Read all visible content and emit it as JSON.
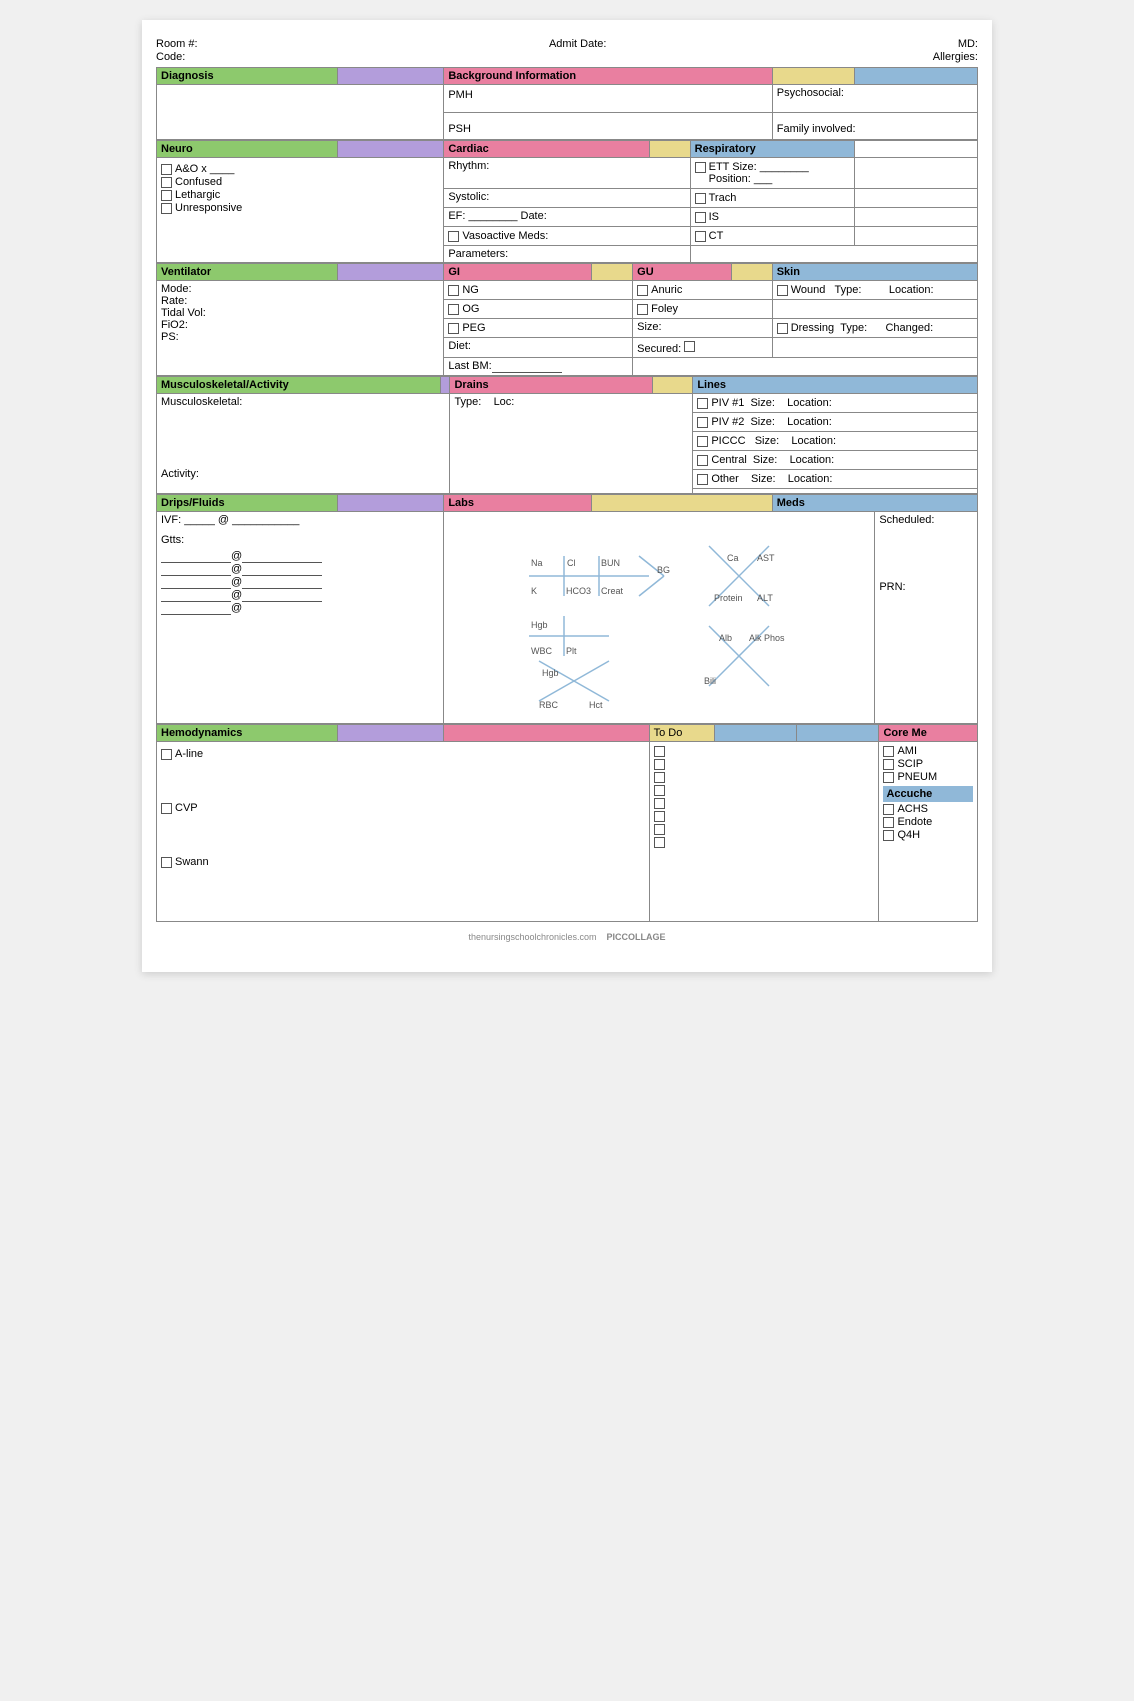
{
  "header": {
    "room_label": "Room #:",
    "admit_label": "Admit Date:",
    "md_label": "MD:",
    "code_label": "Code:",
    "allergies_label": "Allergies:"
  },
  "sections": {
    "diagnosis_label": "Diagnosis",
    "background_label": "Background Information",
    "pmh_label": "PMH",
    "psh_label": "PSH",
    "psychosocial_label": "Psychosocial:",
    "family_label": "Family involved:",
    "neuro_label": "Neuro",
    "cardiac_label": "Cardiac",
    "respiratory_label": "Respiratory",
    "neuro_items": [
      "A&O x ____",
      "Confused",
      "Lethargic",
      "Unresponsive"
    ],
    "cardiac_items": [
      "Rhythm:",
      "Systolic:",
      "EF: ________ Date:",
      "☐ Vasoactive Meds:",
      "Parameters:"
    ],
    "respiratory_items": [
      "ETT  Size: ________ Position: ___",
      "Trach",
      "IS",
      "CT"
    ],
    "ventilator_label": "Ventilator",
    "gi_label": "GI",
    "gu_label": "GU",
    "skin_label": "Skin",
    "ventilator_items": [
      "Mode:",
      "Rate:",
      "Tidal Vol:",
      "FiO2:",
      "PS:"
    ],
    "gi_items": [
      "NG",
      "OG",
      "PEG",
      "Diet:",
      "Last BM:___________"
    ],
    "gu_items": [
      "Anuric",
      "Foley",
      "Size:",
      "Secured: ☐"
    ],
    "skin_items": [
      "Wound   Type:         Location:",
      "Dressing  Type:         Changed:"
    ],
    "msk_label": "Musculoskeletal/Activity",
    "drains_label": "Drains",
    "lines_label": "Lines",
    "msk_items": [
      "Musculoskeletal:",
      "Activity:"
    ],
    "drains_items": [
      "Type:     Loc:"
    ],
    "lines_items": [
      "PIV #1   Size:    Location:",
      "PIV #2   Size:    Location:",
      "PICCC   Size:    Location:",
      "Central  Size:    Location:",
      "Other   Size:    Location:"
    ],
    "drips_label": "Drips/Fluids",
    "labs_label": "Labs",
    "meds_label": "Meds",
    "drips_items": [
      "IVF: _____ @ ___________",
      "Gtts:",
      "@___________",
      "@___________",
      "@___________",
      "@___________",
      "@___________"
    ],
    "meds_items": [
      "Scheduled:",
      "PRN:"
    ],
    "hemo_label": "Hemodynamics",
    "todo_label": "To Do",
    "core_label": "Core Me",
    "hemo_items": [
      "A-line",
      "CVP",
      "Swann"
    ],
    "todo_count": 8,
    "core_items": [
      "AMI",
      "SCIP",
      "PNEUM"
    ],
    "accuche_label": "Accuche",
    "accuche_items": [
      "ACHS",
      "Endote",
      "Q4H"
    ]
  },
  "footer": {
    "website": "thenursingschoolchronicles.com",
    "app": "PICCOLLAGE"
  },
  "colors": {
    "green": "#8dc96d",
    "purple": "#b39ddb",
    "pink": "#e97fa0",
    "yellow": "#e8d98c",
    "blue": "#90b8d8"
  }
}
